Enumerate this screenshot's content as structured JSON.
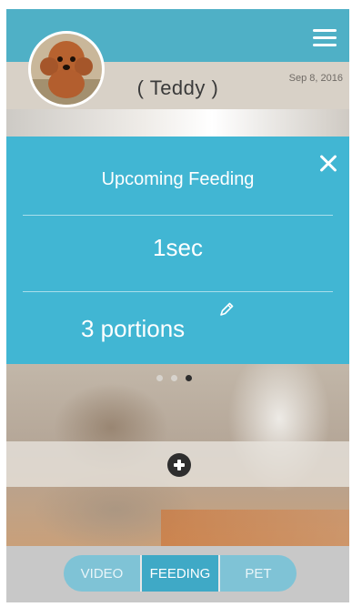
{
  "header": {
    "pet_name": "( Teddy )",
    "date": "Sep 8, 2016"
  },
  "card": {
    "title": "Upcoming Feeding",
    "countdown": "1sec",
    "portions": "3 portions"
  },
  "pager": {
    "total": 3,
    "active_index": 2
  },
  "tabs": [
    {
      "label": "VIDEO",
      "active": false
    },
    {
      "label": "FEEDING",
      "active": true
    },
    {
      "label": "PET",
      "active": false
    }
  ],
  "icons": {
    "menu": "hamburger-menu-icon",
    "close": "close-icon",
    "edit": "pencil-icon",
    "add": "plus-circle-icon"
  },
  "colors": {
    "accent": "#41b6d3",
    "header": "#4fb0c6",
    "tab_active": "#3fa9c6",
    "tab_inactive": "#7fc3d6"
  }
}
